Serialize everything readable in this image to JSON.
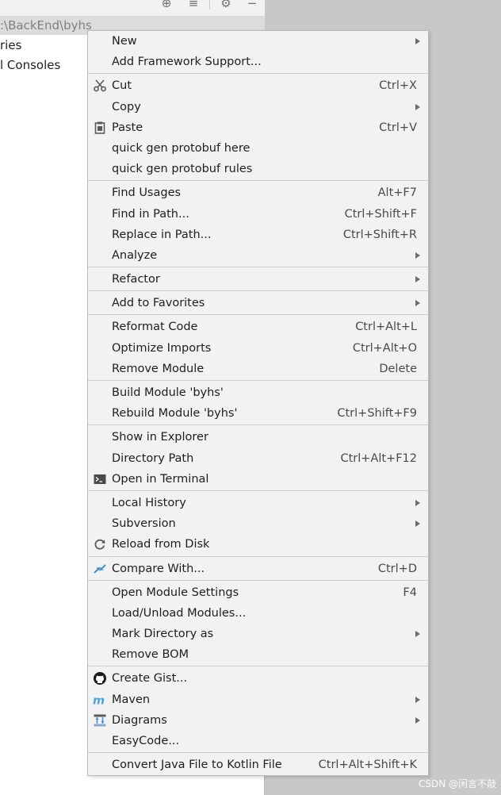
{
  "background": {
    "path": ":\\BackEnd\\byhs",
    "tree_items": [
      "ries",
      "l Consoles"
    ]
  },
  "menu": {
    "groups": [
      [
        {
          "label": "New",
          "submenu": true
        },
        {
          "label": "Add Framework Support..."
        }
      ],
      [
        {
          "label": "Cut",
          "shortcut": "Ctrl+X",
          "icon": "scissors-icon"
        },
        {
          "label": "Copy",
          "submenu": true
        },
        {
          "label": "Paste",
          "shortcut": "Ctrl+V",
          "icon": "clipboard-icon"
        },
        {
          "label": "quick gen protobuf here"
        },
        {
          "label": "quick gen protobuf rules"
        }
      ],
      [
        {
          "label": "Find Usages",
          "shortcut": "Alt+F7"
        },
        {
          "label": "Find in Path...",
          "shortcut": "Ctrl+Shift+F"
        },
        {
          "label": "Replace in Path...",
          "shortcut": "Ctrl+Shift+R"
        },
        {
          "label": "Analyze",
          "submenu": true
        }
      ],
      [
        {
          "label": "Refactor",
          "submenu": true
        }
      ],
      [
        {
          "label": "Add to Favorites",
          "submenu": true
        }
      ],
      [
        {
          "label": "Reformat Code",
          "shortcut": "Ctrl+Alt+L"
        },
        {
          "label": "Optimize Imports",
          "shortcut": "Ctrl+Alt+O"
        },
        {
          "label": "Remove Module",
          "shortcut": "Delete"
        }
      ],
      [
        {
          "label": "Build Module 'byhs'"
        },
        {
          "label": "Rebuild Module 'byhs'",
          "shortcut": "Ctrl+Shift+F9"
        }
      ],
      [
        {
          "label": "Show in Explorer"
        },
        {
          "label": "Directory Path",
          "shortcut": "Ctrl+Alt+F12"
        },
        {
          "label": "Open in Terminal",
          "icon": "terminal-icon"
        }
      ],
      [
        {
          "label": "Local History",
          "submenu": true
        },
        {
          "label": "Subversion",
          "submenu": true
        },
        {
          "label": "Reload from Disk",
          "icon": "reload-icon"
        }
      ],
      [
        {
          "label": "Compare With...",
          "shortcut": "Ctrl+D",
          "icon": "compare-icon"
        }
      ],
      [
        {
          "label": "Open Module Settings",
          "shortcut": "F4"
        },
        {
          "label": "Load/Unload Modules..."
        },
        {
          "label": "Mark Directory as",
          "submenu": true
        },
        {
          "label": "Remove BOM"
        }
      ],
      [
        {
          "label": "Create Gist...",
          "icon": "github-icon"
        },
        {
          "label": "Maven",
          "submenu": true,
          "icon": "maven-icon"
        },
        {
          "label": "Diagrams",
          "submenu": true,
          "icon": "diagrams-icon"
        },
        {
          "label": "EasyCode..."
        }
      ],
      [
        {
          "label": "Convert Java File to Kotlin File",
          "shortcut": "Ctrl+Alt+Shift+K"
        }
      ]
    ]
  },
  "watermark": "CSDN @闲言不敲"
}
